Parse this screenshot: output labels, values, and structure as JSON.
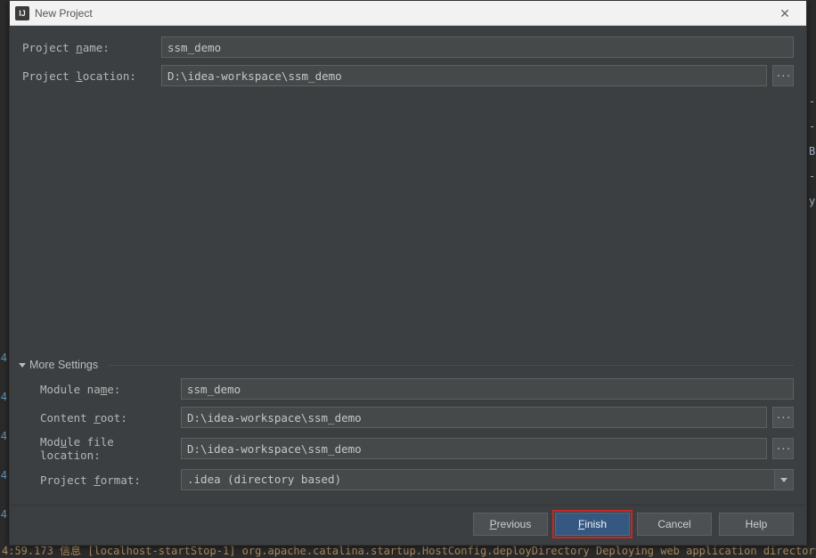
{
  "window": {
    "title": "New Project",
    "app_icon_text": "IJ"
  },
  "fields": {
    "project_name": {
      "label_pre": "Project ",
      "label_m": "n",
      "label_post": "ame:",
      "value": "ssm_demo"
    },
    "project_location": {
      "label_pre": "Project ",
      "label_m": "l",
      "label_post": "ocation:",
      "value": "D:\\idea-workspace\\ssm_demo",
      "browse": "..."
    },
    "more_settings_label": "More Settings",
    "module_name": {
      "label_pre": "Module na",
      "label_m": "m",
      "label_post": "e:",
      "value": "ssm_demo"
    },
    "content_root": {
      "label_pre": "Content ",
      "label_m": "r",
      "label_post": "oot:",
      "value": "D:\\idea-workspace\\ssm_demo",
      "browse": "..."
    },
    "module_file_location": {
      "label_pre": "Mod",
      "label_m": "u",
      "label_post": "le file location:",
      "value": "D:\\idea-workspace\\ssm_demo",
      "browse": "..."
    },
    "project_format": {
      "label_pre": "Project ",
      "label_m": "f",
      "label_post": "ormat:",
      "value": ".idea (directory based)"
    }
  },
  "buttons": {
    "previous": {
      "m": "P",
      "rest": "revious"
    },
    "finish": {
      "m": "F",
      "rest": "inish"
    },
    "cancel": {
      "label": "Cancel"
    },
    "help": {
      "label": "Help"
    }
  },
  "background": {
    "console_line": "4:59.173 信息 [localhost-startStop-1] org.apache.catalina.startup.HostConfig.deployDirectory Deploying web application directory D",
    "gutter": [
      "4",
      "4",
      "4",
      "4",
      "4"
    ],
    "right_chars": [
      "-",
      "-",
      "B",
      "-",
      "y"
    ]
  }
}
